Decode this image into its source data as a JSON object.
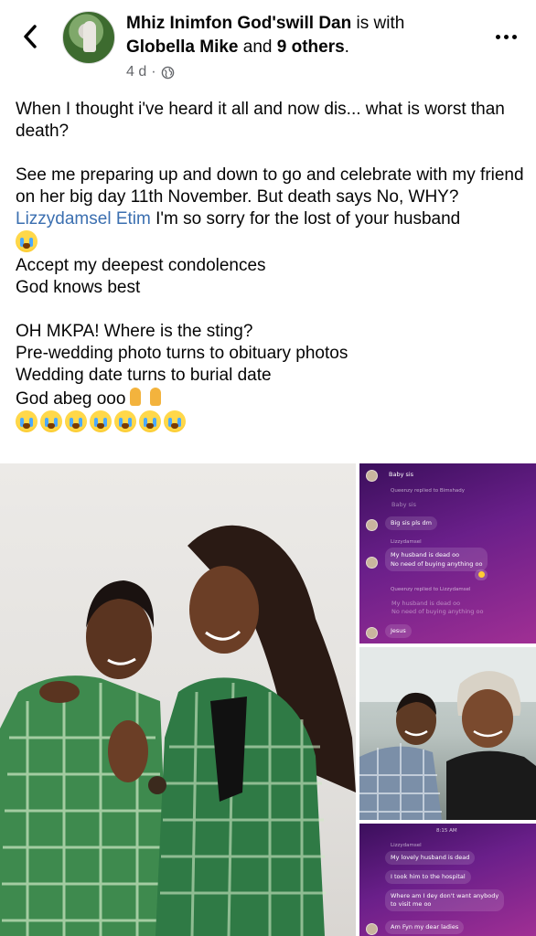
{
  "header": {
    "author": "Mhiz Inimfon God'swill Dan",
    "with_text": "is with",
    "tagged": "Globella Mike",
    "and_text": "and",
    "others": "9 others",
    "period": ".",
    "time": "4 d",
    "separator": "·",
    "audience_icon": "globe-icon"
  },
  "post": {
    "line1": "When I thought i've heard it all and now dis... what is worst than death?",
    "line2": "See me preparing up and down to go and celebrate with my friend on her big day 11th November. But death says No, WHY?",
    "mention": "Lizzydamsel Etim",
    "mention_rest": " I'm so sorry for the lost of your husband",
    "line4": "Accept my deepest condolences",
    "line5": "God knows best",
    "line6": "OH MKPA! Where is the sting?",
    "line7": "Pre-wedding photo turns to obituary photos",
    "line8": "Wedding date turns to burial date",
    "line9": "God abeg ooo",
    "cry_count": 7
  },
  "chat1": {
    "msg1": "Baby sis",
    "reply1": "Queenzy replied to Bimshady",
    "ghost1": "Baby sis",
    "msg2": "Big sis pls dm",
    "sender": "Lizzydamsel",
    "msg3a": "My husband is dead oo",
    "msg3b": "No need of buying anything oo",
    "reply2": "Queenzy replied to Lizzydamsel",
    "ghost2a": "My husband is dead oo",
    "ghost2b": "No need of buying anything oo",
    "msg4": "Jesus"
  },
  "chat2": {
    "time": "8:15 AM",
    "sender": "Lizzydamsel",
    "msg1": "My lovely husband is dead",
    "msg2": "I took him to the hospital",
    "msg3a": "Where am I dey don't want anybody",
    "msg3b": "to visit me oo",
    "msg4": "Am Fyn my dear ladies"
  },
  "colors": {
    "text": "#050505",
    "meta": "#65676b",
    "mention": "#3b6fb0",
    "chat_bg": "#6a1f8a"
  }
}
